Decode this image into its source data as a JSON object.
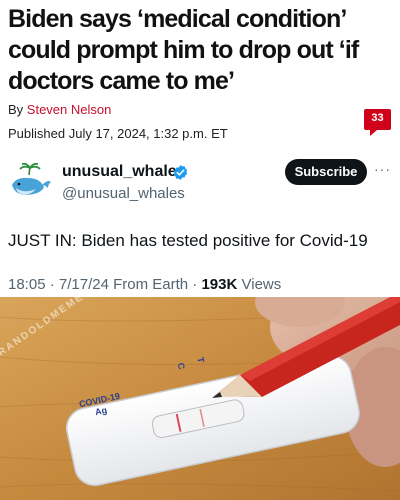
{
  "article": {
    "headline": "Biden says ‘medical condition’ could prompt him to drop out ‘if doctors came to me’",
    "byline_prefix": "By ",
    "author": "Steven Nelson",
    "published": "Published July 17, 2024, 1:32 p.m. ET",
    "comment_count": "33"
  },
  "tweet": {
    "display_name": "unusual_whales",
    "handle": "@unusual_whales",
    "subscribe_label": "Subscribe",
    "more_label": "···",
    "text": "JUST IN: Biden has tested positive for Covid-19",
    "time": "18:05",
    "date": "7/17/24",
    "source": "From Earth",
    "views_count": "193K",
    "views_label": "Views"
  },
  "photo": {
    "test_label_line1": "COVID-19",
    "test_label_line2": "Ag",
    "marker_c": "C",
    "marker_t": "T",
    "watermark": "GRANDOLDMEMES"
  },
  "colors": {
    "accent_red": "#c8102e",
    "verified_blue": "#1d9bf0",
    "wood": "#c98a3e"
  },
  "icons": {
    "verified": "verified-badge-icon",
    "more": "more-icon",
    "avatar": "whale-icon"
  }
}
